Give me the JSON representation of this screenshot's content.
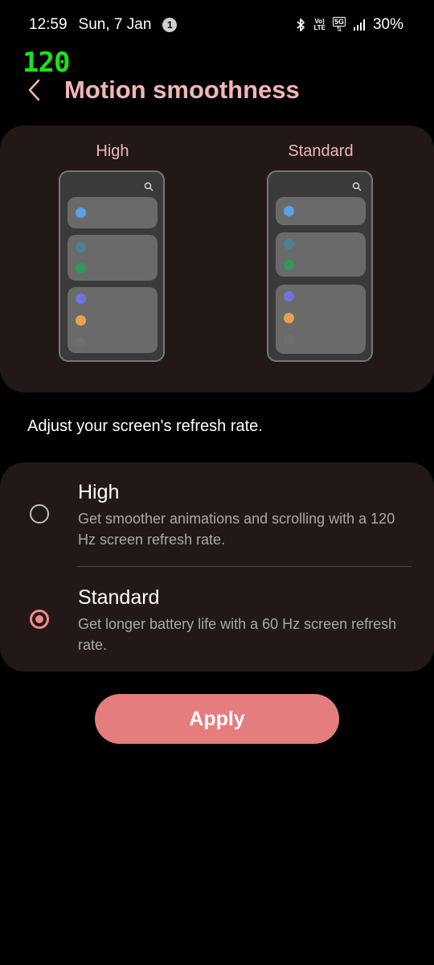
{
  "status_bar": {
    "time": "12:59",
    "date": "Sun, 7 Jan",
    "notification_count": "1",
    "volte_top": "Vo)",
    "volte_bottom": "LTE",
    "network": "5G",
    "battery": "30%"
  },
  "fps_overlay": "120",
  "header": {
    "title": "Motion smoothness"
  },
  "preview": {
    "left_label": "High",
    "right_label": "Standard",
    "dot_colors": [
      "#5aa2e6",
      "#4f7f95",
      "#2e9a56",
      "#6f74e0",
      "#e7a24f",
      "#6f6f6f"
    ]
  },
  "description": "Adjust your screen's refresh rate.",
  "options": [
    {
      "title": "High",
      "subtitle": "Get smoother animations and scrolling with a 120 Hz screen refresh rate.",
      "selected": false
    },
    {
      "title": "Standard",
      "subtitle": "Get longer battery life with a 60 Hz screen refresh rate.",
      "selected": true
    }
  ],
  "apply_label": "Apply",
  "colors": {
    "accent": "#e57c7e",
    "title": "#f2b5b5",
    "card": "#211817"
  }
}
